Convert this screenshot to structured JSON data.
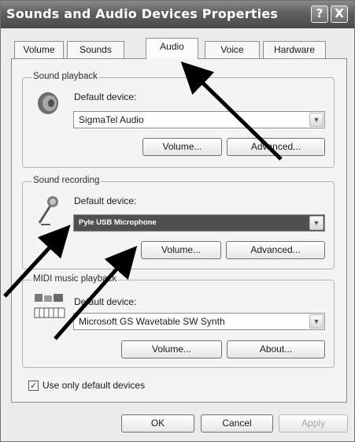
{
  "window": {
    "title": "Sounds and Audio Devices Properties",
    "help_glyph": "?",
    "close_glyph": "X"
  },
  "tabs": [
    "Volume",
    "Sounds",
    "Audio",
    "Voice",
    "Hardware"
  ],
  "active_tab": "Audio",
  "sound_playback": {
    "legend": "Sound playback",
    "default_label": "Default device:",
    "device": "SigmaTel Audio",
    "volume_btn": "Volume...",
    "advanced_btn": "Advanced..."
  },
  "sound_recording": {
    "legend": "Sound recording",
    "default_label": "Default device:",
    "device": "Pyle USB Microphone",
    "volume_btn": "Volume...",
    "advanced_btn": "Advanced..."
  },
  "midi": {
    "legend": "MIDI music playback",
    "default_label": "Default device:",
    "device": "Microsoft GS Wavetable SW Synth",
    "volume_btn": "Volume...",
    "about_btn": "About..."
  },
  "use_default": {
    "label": "Use only default devices",
    "checked": true,
    "check_glyph": "✓"
  },
  "footer": {
    "ok": "OK",
    "cancel": "Cancel",
    "apply": "Apply"
  },
  "dropdown_glyph": "▼"
}
